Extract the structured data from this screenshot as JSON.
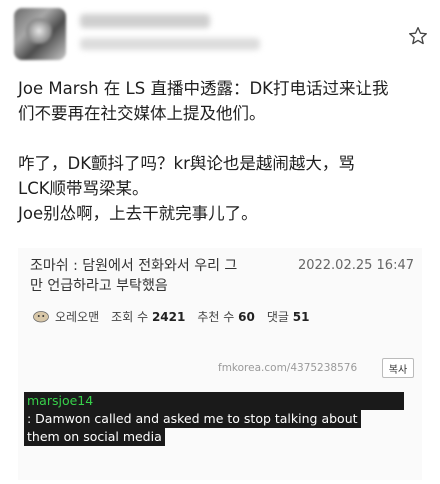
{
  "post": {
    "lines": [
      "Joe Marsh 在 LS 直播中透露：DK打电话过来让我",
      "们不要再在社交媒体上提及他们。",
      "",
      "咋了，DK颤抖了吗？kr舆论也是越闹越大，骂",
      "LCK顺带骂梁某。",
      "Joe别怂啊，上去干就完事儿了。"
    ]
  },
  "screenshot": {
    "title_line1": "조마쉬 : 담원에서 전화와서 우리 그",
    "title_line2": "만 언급하라고 부탁했음",
    "date": "2022.02.25 16:47",
    "author": "오레오맨",
    "views_label": "조회 수",
    "views": "2421",
    "recommend_label": "추천 수",
    "recommend": "60",
    "comments_label": "댓글",
    "comments": "51",
    "url": "fmkorea.com/4375238576",
    "copy_label": "복사",
    "caption_user": "marsjoe14",
    "caption_line1": ": Damwon called and asked me to stop talking about",
    "caption_line2": "them on social media"
  }
}
